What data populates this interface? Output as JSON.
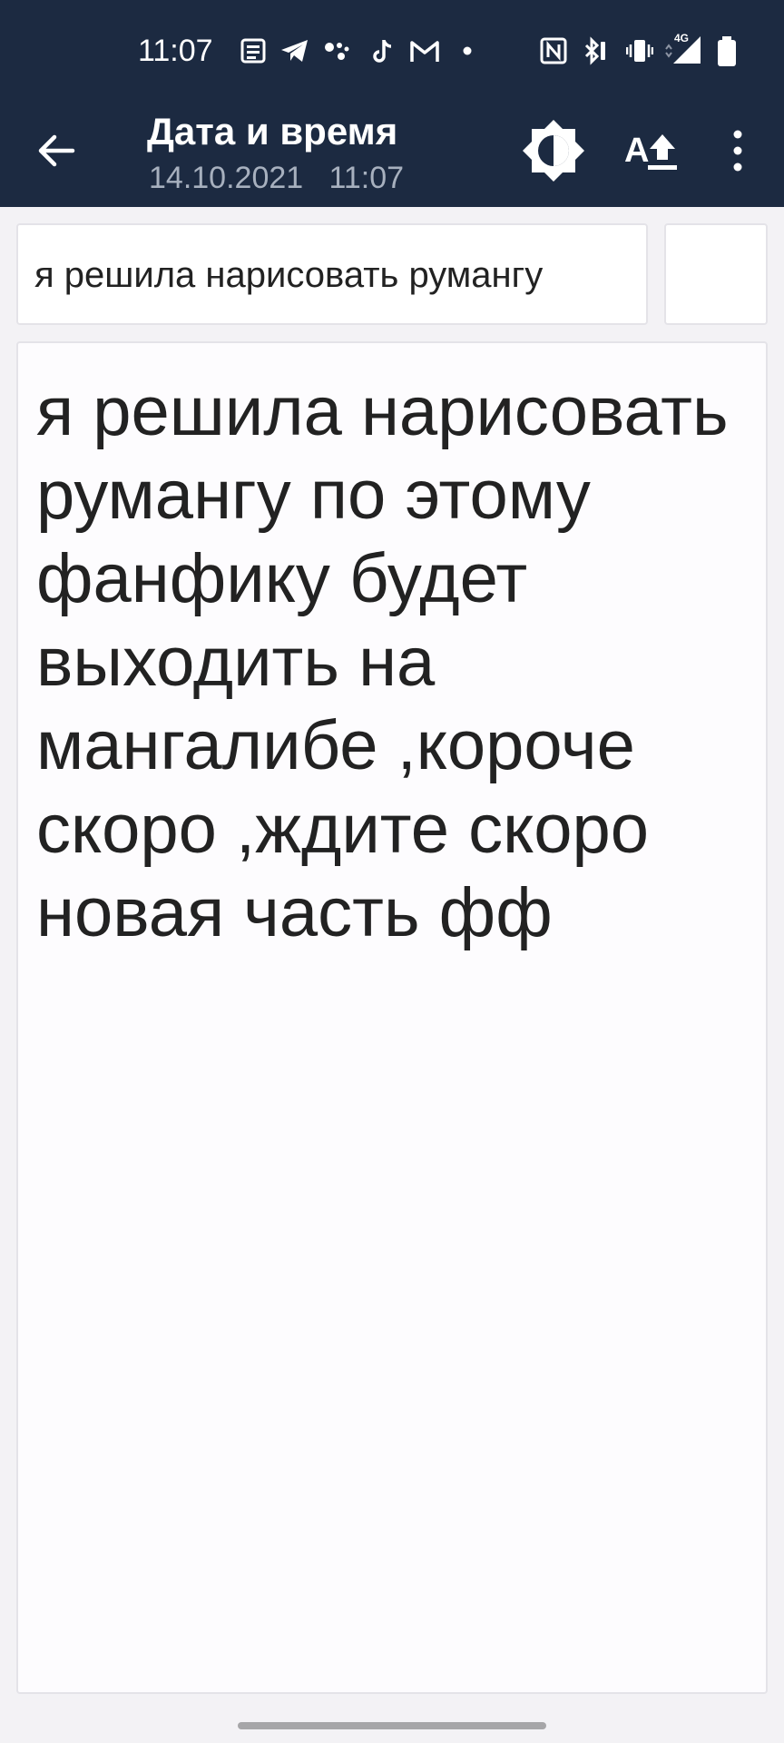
{
  "status_bar": {
    "time": "11:07",
    "icons": [
      "news-icon",
      "telegram-icon",
      "assistant-icon",
      "tiktok-icon",
      "gmail-icon",
      "dot-icon",
      "nfc-icon",
      "bluetooth-icon",
      "vibrate-icon",
      "signal-4g-icon",
      "battery-icon"
    ],
    "network": "4G"
  },
  "app_bar": {
    "title": "Дата и время",
    "date": "14.10.2021",
    "time": "11:07",
    "icons": [
      "back-arrow-icon",
      "theme-brightness-icon",
      "font-size-icon",
      "more-vert-icon"
    ]
  },
  "note": {
    "title": "я решила нарисовать румангу",
    "body": "я решила нарисовать румангу по этому фанфику будет выходить на мангалибе ,короче скоро ,ждите скоро новая часть фф"
  },
  "colors": {
    "header_bg": "#1c2a41",
    "subtitle": "#a7b0be",
    "page_bg": "#f3f2f5",
    "text": "#222222"
  }
}
